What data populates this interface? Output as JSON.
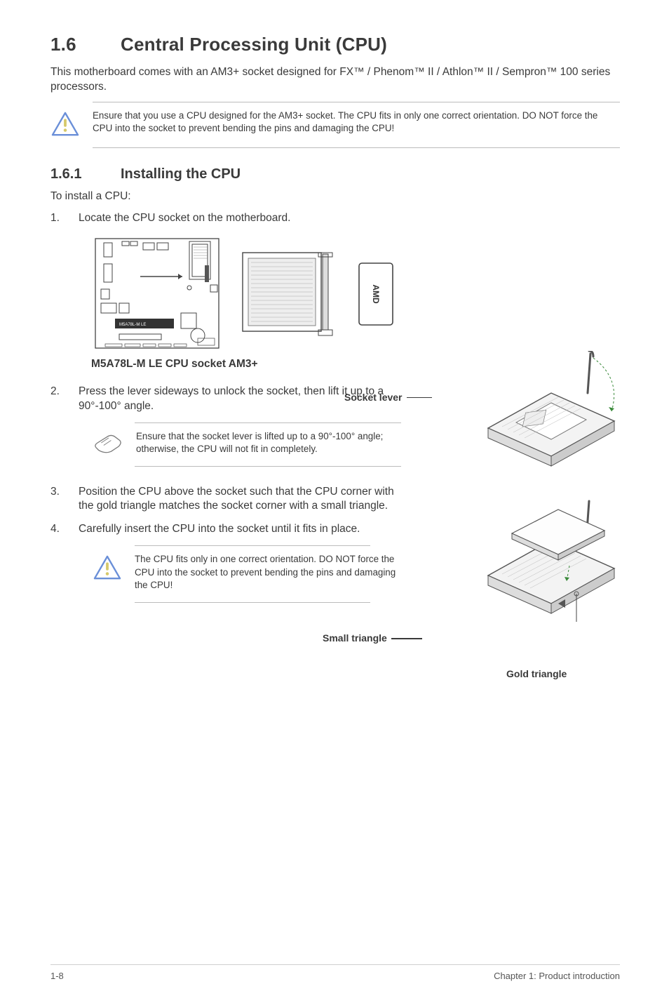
{
  "section": {
    "number": "1.6",
    "title": "Central Processing Unit (CPU)",
    "intro": "This motherboard comes with an AM3+ socket designed for FX™ / Phenom™ II / Athlon™ II / Sempron™ 100 series processors."
  },
  "warning1": "Ensure that you use a CPU designed for the AM3+ socket. The CPU fits in only one correct orientation. DO NOT force the CPU into the socket to prevent bending the pins and damaging the CPU!",
  "sub": {
    "number": "1.6.1",
    "title": "Installing the CPU"
  },
  "intro2": "To install a CPU:",
  "steps": {
    "s1n": "1.",
    "s1t": "Locate the CPU socket on the motherboard.",
    "s2n": "2.",
    "s2t": "Press the lever sideways to unlock the socket, then lift it up to a 90°-100° angle.",
    "s3n": "3.",
    "s3t": "Position the CPU above the socket such that the CPU corner with the gold triangle matches the socket corner with a small triangle.",
    "s4n": "4.",
    "s4t": "Carefully insert the CPU into the socket until it fits in place."
  },
  "figcaption": "M5A78L-M LE CPU socket AM3+",
  "tip1": "Ensure that the socket lever is lifted up to a 90°-100° angle; otherwise, the CPU will not fit in completely.",
  "warning2": "The CPU fits only in one correct orientation. DO NOT force the CPU into the socket to prevent bending the pins and damaging the CPU!",
  "labels": {
    "socket_lever": "Socket lever",
    "small_triangle": "Small triangle",
    "gold_triangle": "Gold triangle"
  },
  "footer": {
    "left": "1-8",
    "right": "Chapter 1: Product introduction"
  },
  "chip_label": "AMD"
}
